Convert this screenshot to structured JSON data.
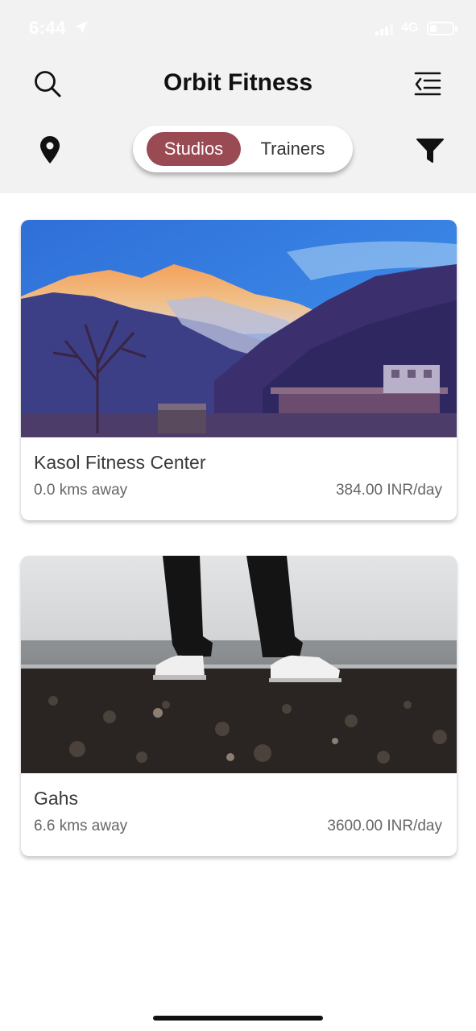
{
  "status_bar": {
    "time": "6:44",
    "network": "4G",
    "location_icon": "location-arrow-icon",
    "battery_icon": "battery-icon",
    "signal_icon": "signal-icon"
  },
  "header": {
    "title": "Orbit Fitness",
    "search_icon": "search-icon",
    "menu_icon": "menu-collapse-icon",
    "location_icon": "map-pin-icon",
    "filter_icon": "filter-icon"
  },
  "segment": {
    "options": [
      "Studios",
      "Trainers"
    ],
    "selected": "Studios"
  },
  "studios": [
    {
      "name": "Kasol Fitness Center",
      "distance": "0.0 kms away",
      "price": "384.00 INR/day",
      "image": "mountain-landscape-photo"
    },
    {
      "name": "Gahs",
      "distance": "6.6 kms away",
      "price": "3600.00 INR/day",
      "image": "sneakers-on-gravel-photo"
    }
  ],
  "colors": {
    "accent": "#9a4a52",
    "header_bg": "#f2f2f2",
    "card_bg": "#ffffff"
  }
}
